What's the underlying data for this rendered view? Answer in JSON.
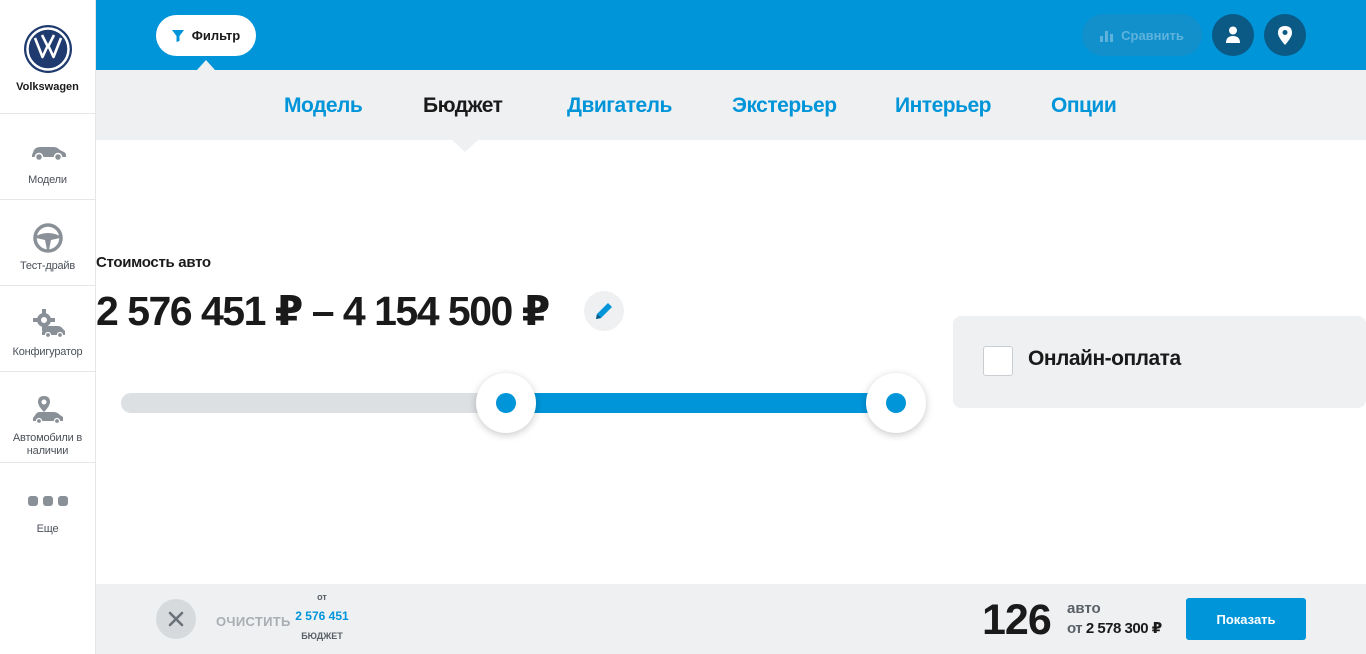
{
  "sidebar": {
    "brand": "Volkswagen",
    "items": [
      {
        "label": "Модели",
        "icon": "car-icon"
      },
      {
        "label": "Тест-драйв",
        "icon": "steering-wheel-icon"
      },
      {
        "label": "Конфигуратор",
        "icon": "gear-car-icon"
      },
      {
        "label": "Автомобили в наличии",
        "icon": "car-pin-icon"
      },
      {
        "label": "Еще",
        "icon": "more-dots-icon"
      }
    ]
  },
  "topbar": {
    "filter_label": "Фильтр",
    "compare_label": "Сравнить"
  },
  "tabs": [
    {
      "label": "Модель",
      "active": false
    },
    {
      "label": "Бюджет",
      "active": true
    },
    {
      "label": "Двигатель",
      "active": false
    },
    {
      "label": "Экстерьер",
      "active": false
    },
    {
      "label": "Интерьер",
      "active": false
    },
    {
      "label": "Опции",
      "active": false
    }
  ],
  "budget": {
    "label": "Стоимость авто",
    "range_text": "2 576 451 ₽ – 4 154 500 ₽",
    "slider_min_fraction": 0.478,
    "slider_max_fraction": 0.963
  },
  "online_payment": {
    "label": "Онлайн-оплата",
    "checked": false
  },
  "footer": {
    "clear_label": "ОЧИСТИТЬ",
    "chip_prefix": "от",
    "chip_value": "2 576 451",
    "chip_caption": "БЮДЖЕТ",
    "count": "126",
    "count_unit": "авто",
    "from_prefix": "от",
    "from_amount": "2 578 300 ₽",
    "show_label": "Показать"
  },
  "colors": {
    "accent": "#0095d9",
    "dark_button": "#0a5a85",
    "panel": "#eef0f2"
  }
}
